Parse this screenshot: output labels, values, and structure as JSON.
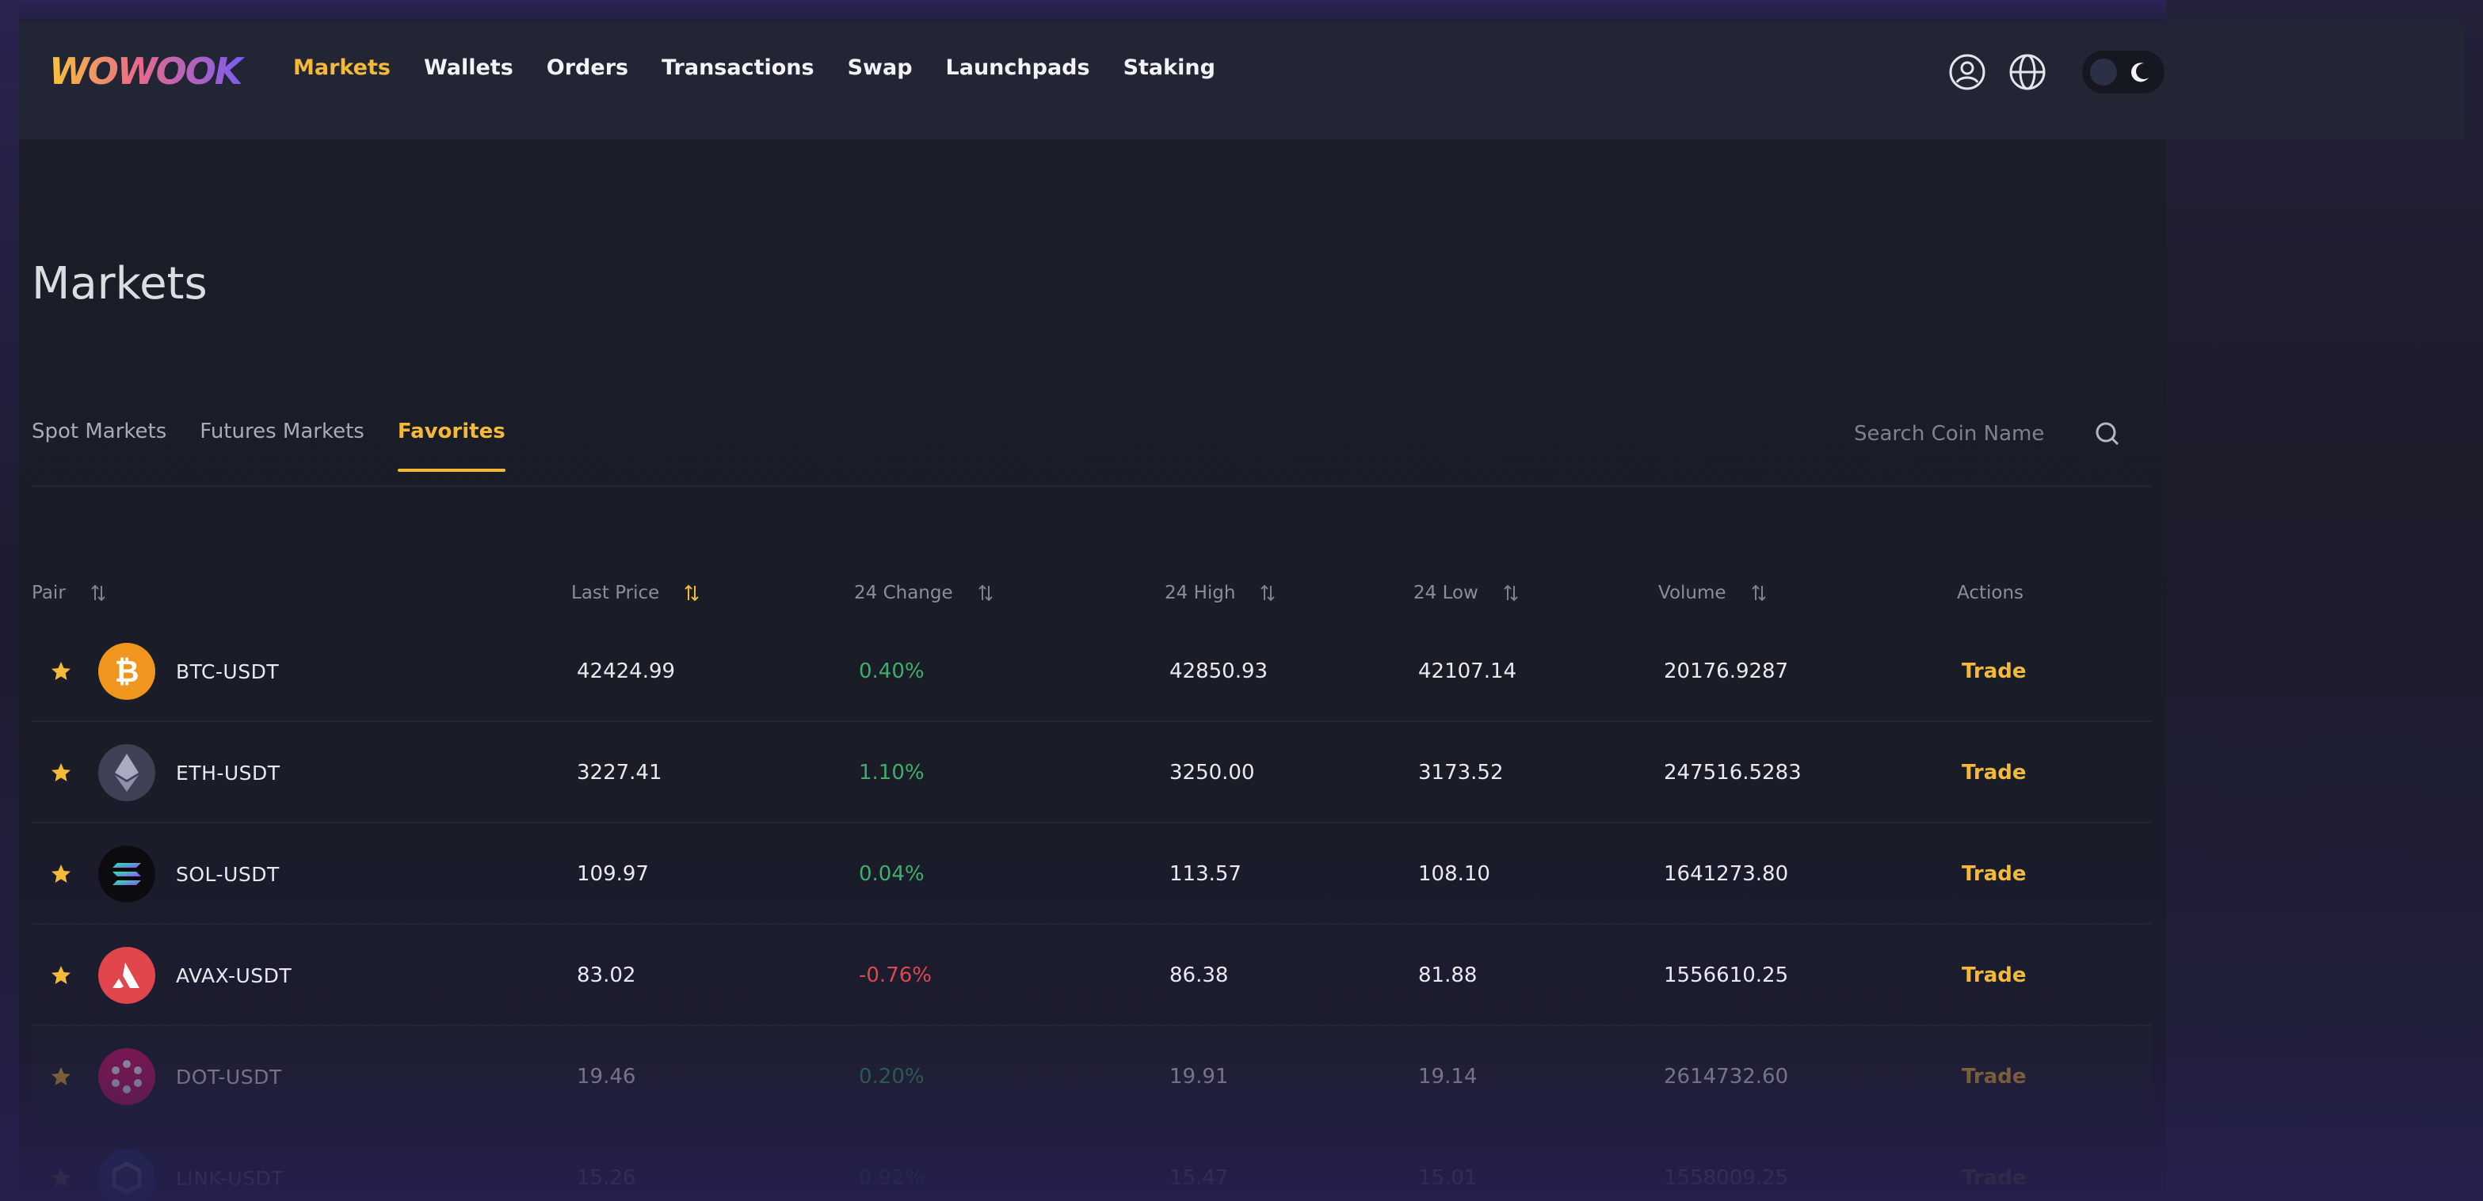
{
  "brand": {
    "logo_text": "WOWOOK"
  },
  "nav": {
    "items": [
      {
        "label": "Markets",
        "active": true
      },
      {
        "label": "Wallets",
        "active": false
      },
      {
        "label": "Orders",
        "active": false
      },
      {
        "label": "Transactions",
        "active": false
      },
      {
        "label": "Swap",
        "active": false
      },
      {
        "label": "Launchpads",
        "active": false
      },
      {
        "label": "Staking",
        "active": false
      }
    ]
  },
  "header_icons": [
    "user-icon",
    "globe-icon",
    "theme-toggle-moon-icon"
  ],
  "page": {
    "title": "Markets"
  },
  "tabs": [
    {
      "label": "Spot Markets",
      "active": false
    },
    {
      "label": "Futures Markets",
      "active": false
    },
    {
      "label": "Favorites",
      "active": true
    }
  ],
  "search": {
    "placeholder": "Search Coin Name"
  },
  "table": {
    "columns": [
      "Pair",
      "Last Price",
      "24 Change",
      "24 High",
      "24 Low",
      "Volume",
      "Actions"
    ],
    "rows": [
      {
        "pair": "BTC-USDT",
        "coin": "btc-icon",
        "last_price": "42424.99",
        "change": "0.40%",
        "high": "42850.93",
        "low": "42107.14",
        "volume": "20176.9287",
        "action": "Trade"
      },
      {
        "pair": "ETH-USDT",
        "coin": "eth-icon",
        "last_price": "3227.41",
        "change": "1.10%",
        "high": "3250.00",
        "low": "3173.52",
        "volume": "247516.5283",
        "action": "Trade"
      },
      {
        "pair": "SOL-USDT",
        "coin": "sol-icon",
        "last_price": "109.97",
        "change": "0.04%",
        "high": "113.57",
        "low": "108.10",
        "volume": "1641273.80",
        "action": "Trade"
      },
      {
        "pair": "AVAX-USDT",
        "coin": "avax-icon",
        "last_price": "83.02",
        "change": "-0.76%",
        "high": "86.38",
        "low": "81.88",
        "volume": "1556610.25",
        "action": "Trade"
      },
      {
        "pair": "DOT-USDT",
        "coin": "dot-icon",
        "last_price": "19.46",
        "change": "0.20%",
        "high": "19.91",
        "low": "19.14",
        "volume": "2614732.60",
        "action": "Trade"
      },
      {
        "pair": "LINK-USDT",
        "coin": "link-icon",
        "last_price": "15.26",
        "change": "0.92%",
        "high": "15.47",
        "low": "15.01",
        "volume": "1558009.25",
        "action": "Trade"
      }
    ]
  },
  "colors": {
    "accent": "#f5b939",
    "positive": "#3fae6a",
    "negative": "#e0464b",
    "background": "#1b1e29",
    "header": "#222534"
  }
}
